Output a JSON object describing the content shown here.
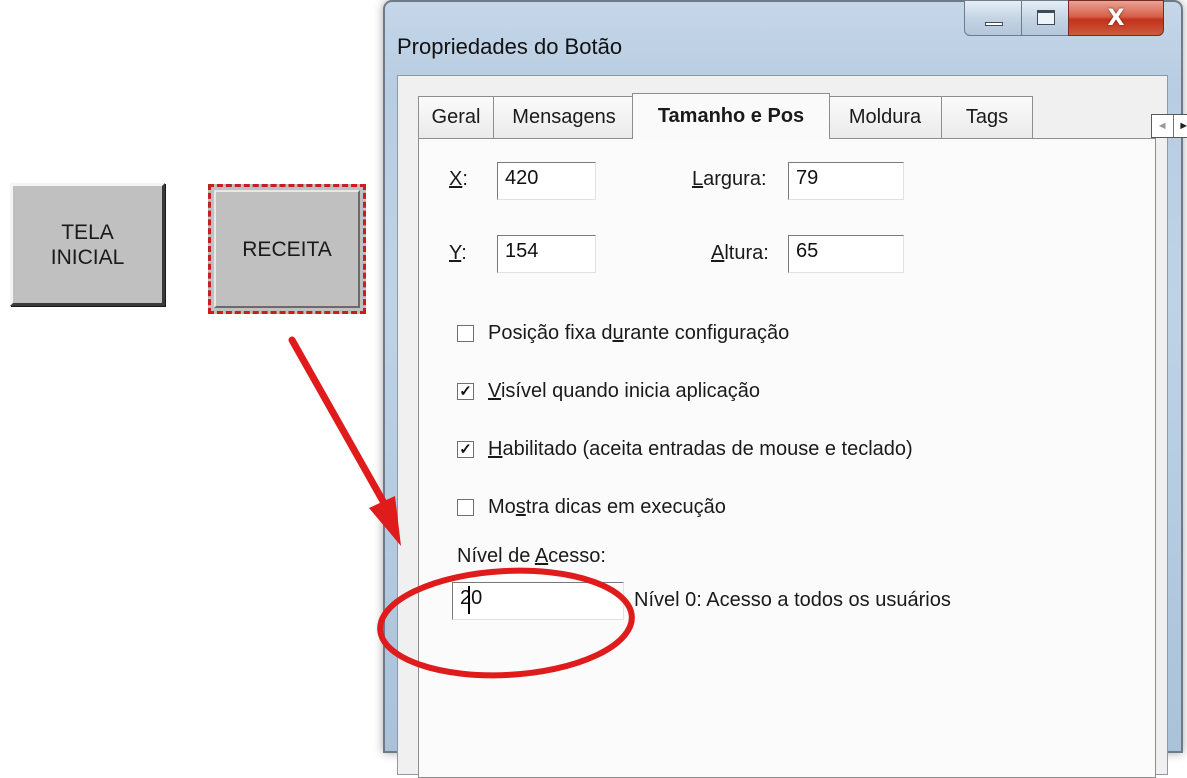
{
  "canvas": {
    "button_tela_inicial": "TELA\nINICIAL",
    "button_receita": "RECEITA"
  },
  "dialog": {
    "title": "Propriedades do Botão",
    "window_controls": {
      "minimize_icon": "minimize-icon",
      "maximize_icon": "maximize-icon",
      "close_icon": "close-icon",
      "close_glyph": "X"
    },
    "tabs": [
      {
        "label": "Geral",
        "active": false
      },
      {
        "label": "Mensagens",
        "active": false
      },
      {
        "label": "Tamanho e Pos",
        "active": true
      },
      {
        "label": "Moldura",
        "active": false
      },
      {
        "label": "Tags",
        "active": false
      }
    ],
    "tab_scroll": {
      "left": "◄",
      "right": "►"
    },
    "fields": {
      "x": {
        "label_key": "X",
        "label_rest": ":",
        "value": "420"
      },
      "y": {
        "label_key": "Y",
        "label_rest": ":",
        "value": "154"
      },
      "largura": {
        "label_key": "L",
        "label_rest": "argura:",
        "value": "79"
      },
      "altura": {
        "label_key": "A",
        "label_rest": "ltura:",
        "value": "65"
      }
    },
    "checkboxes": [
      {
        "pre": "Posição fixa d",
        "key": "u",
        "post": "rante configuração",
        "checked": false
      },
      {
        "pre": "",
        "key": "V",
        "post": "isível quando inicia aplicação",
        "checked": true
      },
      {
        "pre": "",
        "key": "H",
        "post": "abilitado (aceita entradas de mouse e teclado)",
        "checked": true
      },
      {
        "pre": "Mo",
        "key": "s",
        "post": "tra dicas em execução",
        "checked": false
      }
    ],
    "access": {
      "label_pre": "Nível de ",
      "label_key": "A",
      "label_post": "cesso:",
      "value": "20",
      "hint": "Nível 0: Acesso a todos os usuários"
    }
  },
  "annotation": {
    "color": "#e01b1b"
  }
}
